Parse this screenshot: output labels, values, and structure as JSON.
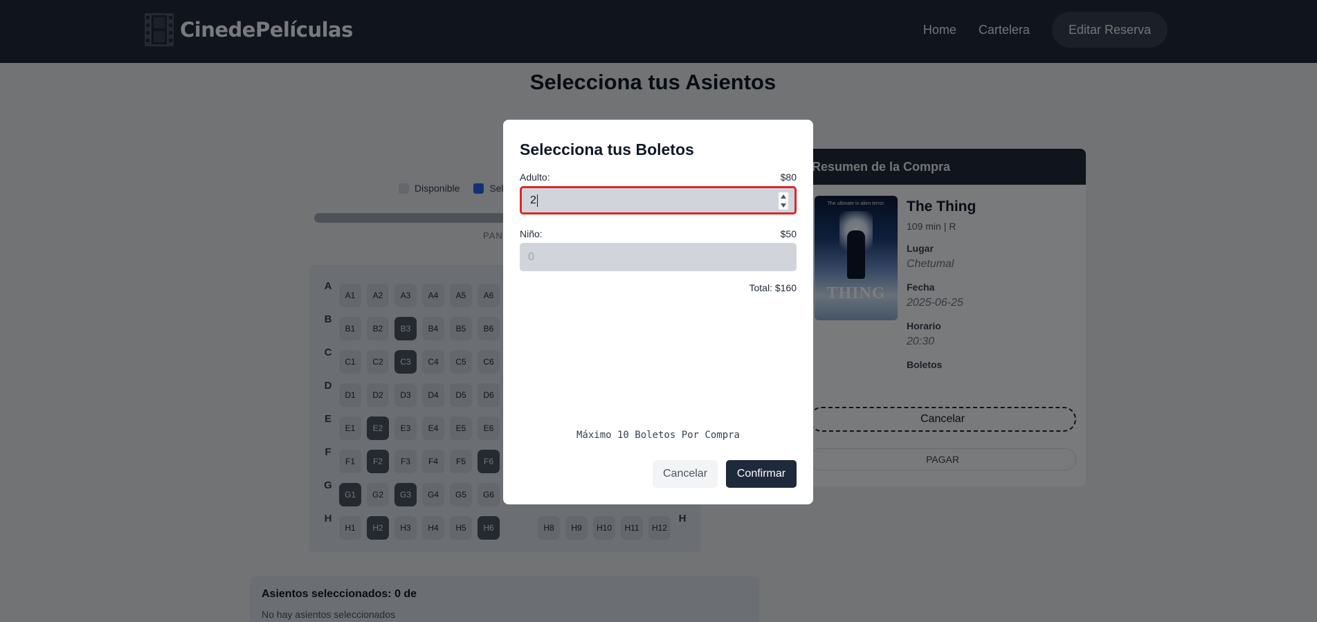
{
  "header": {
    "brand": "CinedePelículas",
    "logo_icon": "film-strip-icon",
    "nav": {
      "home": "Home",
      "cartelera": "Cartelera",
      "edit": "Editar Reserva"
    }
  },
  "page": {
    "title": "Selecciona tus Asientos"
  },
  "legend": {
    "disponible": "Disponible",
    "seleccionado": "Sele"
  },
  "screen_label": "PANT",
  "seats": {
    "left_rows": [
      {
        "row": "A",
        "seats": [
          "A1",
          "A2",
          "A3",
          "A4",
          "A5",
          "A6"
        ],
        "occupied": []
      },
      {
        "row": "B",
        "seats": [
          "B1",
          "B2",
          "B3",
          "B4",
          "B5",
          "B6"
        ],
        "occupied": [
          "B3"
        ]
      },
      {
        "row": "C",
        "seats": [
          "C1",
          "C2",
          "C3",
          "C4",
          "C5",
          "C6"
        ],
        "occupied": [
          "C3"
        ]
      },
      {
        "row": "D",
        "seats": [
          "D1",
          "D2",
          "D3",
          "D4",
          "D5",
          "D6"
        ],
        "occupied": []
      },
      {
        "row": "E",
        "seats": [
          "E1",
          "E2",
          "E3",
          "E4",
          "E5",
          "E6"
        ],
        "occupied": [
          "E2"
        ]
      },
      {
        "row": "F",
        "seats": [
          "F1",
          "F2",
          "F3",
          "F4",
          "F5",
          "F6"
        ],
        "occupied": [
          "F2",
          "F6"
        ]
      },
      {
        "row": "G",
        "seats": [
          "G1",
          "G2",
          "G3",
          "G4",
          "G5",
          "G6"
        ],
        "occupied": [
          "G1",
          "G3"
        ]
      },
      {
        "row": "H",
        "seats": [
          "H1",
          "H2",
          "H3",
          "H4",
          "H5",
          "H6"
        ],
        "occupied": [
          "H2",
          "H6"
        ]
      }
    ],
    "right_visible": {
      "row": "H",
      "seats": [
        "H8",
        "H9",
        "H10",
        "H11",
        "H12"
      ]
    }
  },
  "selected": {
    "title": "Asientos seleccionados: 0 de",
    "empty": "No hay asientos seleccionados"
  },
  "summary": {
    "title": "Resumen de la Compra",
    "poster": {
      "tagline": "The ultimate in alien terror.",
      "title": "THING"
    },
    "movie": "The Thing",
    "meta": "109 min  |  R",
    "lugar_label": "Lugar",
    "lugar": "Chetumal",
    "fecha_label": "Fecha",
    "fecha": "2025-06-25",
    "horario_label": "Horario",
    "horario": "20:30",
    "boletos_label": "Boletos",
    "cancel": "Cancelar",
    "pay": "PAGAR"
  },
  "modal": {
    "title": "Selecciona tus Boletos",
    "adult_label": "Adulto:",
    "adult_price": "$80",
    "adult_value": "2",
    "child_label": "Niño:",
    "child_price": "$50",
    "child_placeholder": "0",
    "total": "Total: $160",
    "max_note": "Máximo 10 Boletos Por Compra",
    "cancel": "Cancelar",
    "confirm": "Confirmar"
  }
}
